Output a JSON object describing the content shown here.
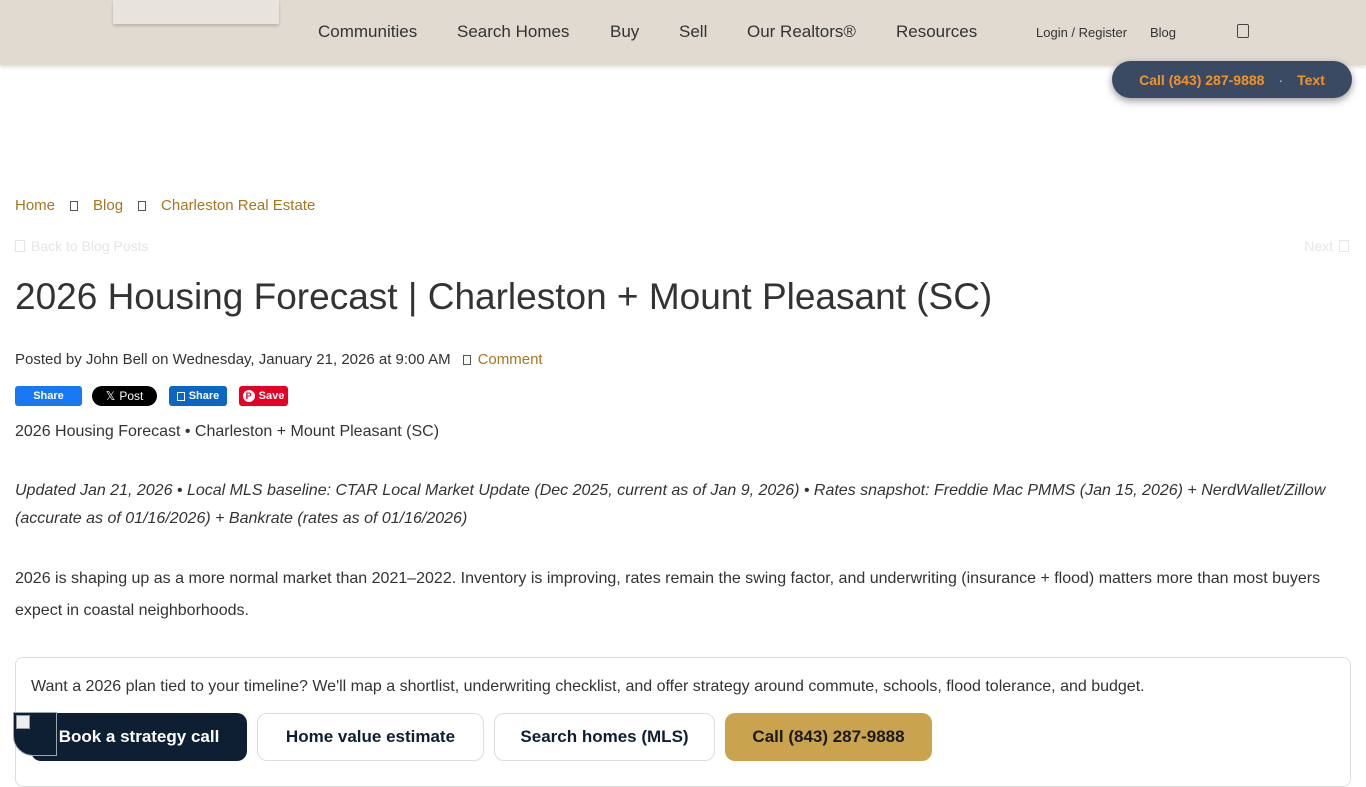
{
  "header": {
    "nav": [
      "Communities",
      "Search Homes",
      "Buy",
      "Sell",
      "Our Realtors®",
      "Resources"
    ],
    "login": "Login / Register",
    "blog": "Blog",
    "call_pill": {
      "call": "Call (843) 287-9888",
      "sep": "·",
      "text": "Text"
    }
  },
  "breadcrumb": [
    "Home",
    "Blog",
    "Charleston Real Estate"
  ],
  "back_label": "Back to Blog Posts",
  "next_label": "Next",
  "post": {
    "title": "2026 Housing Forecast | Charleston + Mount Pleasant (SC)",
    "meta_prefix": "Posted by John Bell on Wednesday, January 21, 2026 at 9:00 AM",
    "comment": "Comment",
    "share": {
      "facebook": "Share",
      "x": "Post",
      "linkedin": "Share",
      "pinterest": "Save"
    },
    "p1": "2026 Housing Forecast • Charleston + Mount Pleasant (SC)",
    "p2": "Updated Jan 21, 2026 • Local MLS baseline: CTAR Local Market Update (Dec 2025, current as of Jan 9, 2026) • Rates snapshot: Freddie Mac PMMS (Jan 15, 2026) + NerdWallet/Zillow (accurate as of 01/16/2026) + Bankrate (rates as of 01/16/2026)",
    "p3": "2026 is shaping up as a more normal market than 2021–2022. Inventory is improving, rates remain the swing factor, and underwriting (insurance + flood) matters more than most buyers expect in coastal neighborhoods."
  },
  "cta": {
    "text": "Want a 2026 plan tied to your timeline? We'll map a shortlist, underwriting checklist, and offer strategy around commute, schools, flood tolerance, and budget.",
    "buttons": [
      "Book a strategy call",
      "Home value estimate",
      "Search homes (MLS)",
      "Call (843) 287-9888"
    ]
  },
  "colors": {
    "header_bg": "#e0dad1",
    "link": "#a8761e",
    "pill_bg": "#3b4a63",
    "pill_text": "#f0932b",
    "navy": "#0f1f33",
    "gold": "#c9a34e"
  }
}
